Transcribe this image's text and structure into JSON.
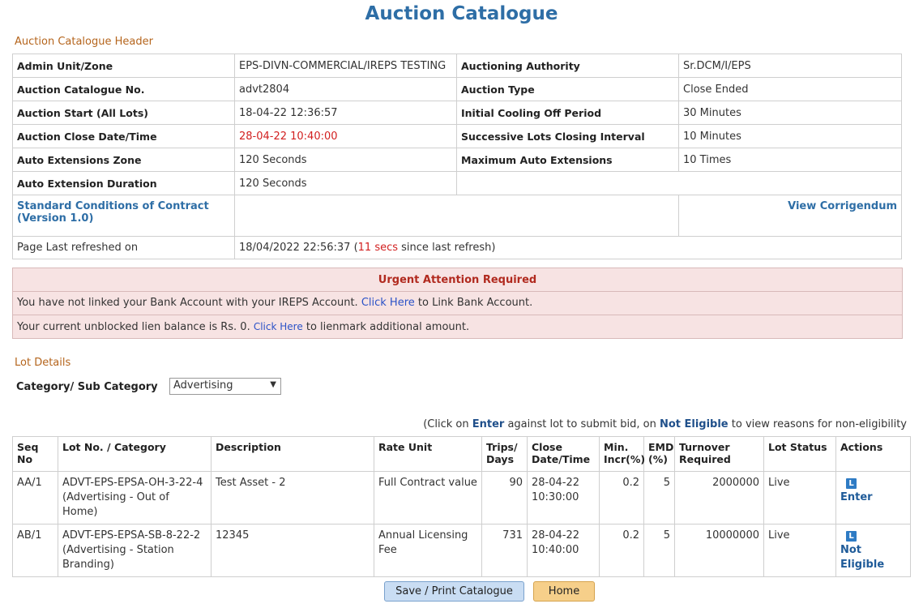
{
  "page_title": "Auction Catalogue",
  "header_section_label": "Auction Catalogue Header",
  "header_rows": [
    {
      "l1": "Admin Unit/Zone",
      "v1": "EPS-DIVN-COMMERCIAL/IREPS TESTING",
      "l2": "Auctioning Authority",
      "v2": "Sr.DCM/I/EPS"
    },
    {
      "l1": "Auction Catalogue No.",
      "v1": "advt2804",
      "l2": "Auction Type",
      "v2": "Close Ended"
    },
    {
      "l1": "Auction Start (All Lots)",
      "v1": "18-04-22 12:36:57",
      "l2": "Initial Cooling Off Period",
      "v2": "30 Minutes"
    },
    {
      "l1": "Auction Close Date/Time",
      "v1": "28-04-22 10:40:00",
      "l2": "Successive Lots Closing Interval",
      "v2": "10 Minutes"
    },
    {
      "l1": "Auto Extensions Zone",
      "v1": "120  Seconds",
      "l2": "Maximum Auto Extensions",
      "v2": "10  Times"
    },
    {
      "l1": "Auto Extension Duration",
      "v1": "120 Seconds"
    }
  ],
  "standard_conditions_link": "Standard Conditions of Contract (Version 1.0)",
  "view_corrigendum_link": "View Corrigendum",
  "refresh": {
    "label": "Page Last refreshed on",
    "datetime": "18/04/2022 22:56:37 (",
    "secs": "11  secs",
    "suffix": " since last refresh)"
  },
  "urgent": {
    "title": "Urgent Attention Required",
    "line1_pre": "You have not linked your Bank Account with your IREPS Account. ",
    "line1_link": "Click Here",
    "line1_post": " to Link Bank Account.",
    "line2_pre": "Your current unblocked lien balance is Rs. 0. ",
    "line2_link": "Click Here",
    "line2_post": " to lienmark additional amount."
  },
  "lot_section_label": "Lot Details",
  "category_label": "Category/ Sub Category",
  "category_selected": "Advertising",
  "hint": {
    "p1": "(Click on ",
    "enter": "Enter",
    "p2": " against lot to submit bid, on ",
    "not_eligible": "Not Eligible",
    "p3": " to view reasons for non-eligibility"
  },
  "lot_columns": [
    "Seq No",
    "Lot No. / Category",
    "Description",
    "Rate Unit",
    "Trips/ Days",
    "Close Date/Time",
    "Min. Incr(%)",
    "EMD (%)",
    "Turnover Required",
    "Lot Status",
    "Actions"
  ],
  "lots": [
    {
      "seq": "AA/1",
      "lot": "ADVT-EPS-EPSA-OH-3-22-4 (Advertising - Out of Home)",
      "desc": "Test Asset - 2",
      "rate": "Full Contract value",
      "trips": "90",
      "close": "28-04-22 10:30:00",
      "incr": "0.2",
      "emd": "5",
      "turnover": "2000000",
      "status": "Live",
      "action": "Enter"
    },
    {
      "seq": "AB/1",
      "lot": "ADVT-EPS-EPSA-SB-8-22-2 (Advertising - Station Branding)",
      "desc": "12345",
      "rate": "Annual Licensing Fee",
      "trips": "731",
      "close": "28-04-22 10:40:00",
      "incr": "0.2",
      "emd": "5",
      "turnover": "10000000",
      "status": "Live",
      "action": "Not Eligible"
    }
  ],
  "action_icon_letter": "L",
  "buttons": {
    "save_print": "Save / Print Catalogue",
    "home": "Home"
  }
}
